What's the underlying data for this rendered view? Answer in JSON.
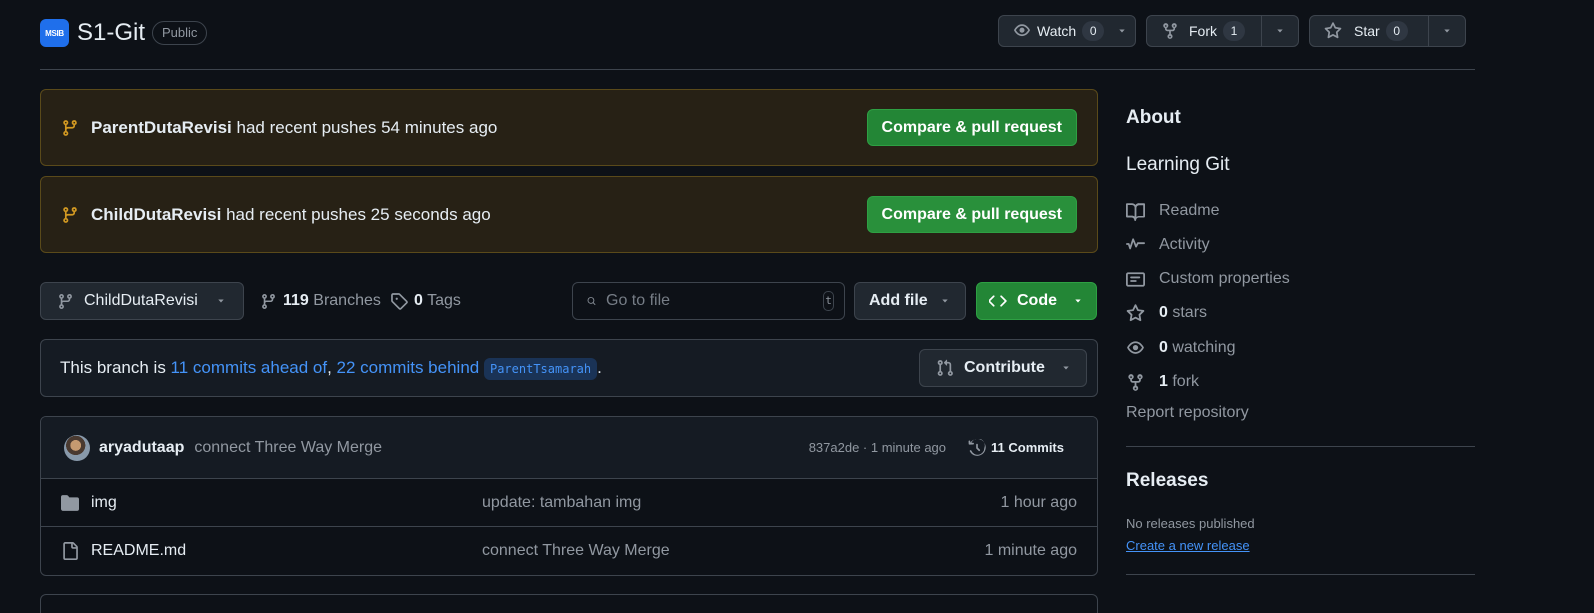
{
  "header": {
    "logo_text": "MSIB",
    "repo_name": "S1-Git",
    "visibility": "Public",
    "watch": {
      "label": "Watch",
      "count": "0"
    },
    "fork": {
      "label": "Fork",
      "count": "1"
    },
    "star": {
      "label": "Star",
      "count": "0"
    }
  },
  "banners": [
    {
      "branch": "ParentDutaRevisi",
      "text": " had recent pushes 54 minutes ago",
      "button": "Compare & pull request"
    },
    {
      "branch": "ChildDutaRevisi",
      "text": " had recent pushes 25 seconds ago",
      "button": "Compare & pull request"
    }
  ],
  "toolbar": {
    "current_branch": "ChildDutaRevisi",
    "branches_count": "119",
    "branches_label": "Branches",
    "tags_count": "0",
    "tags_label": "Tags",
    "search_placeholder": "Go to file",
    "search_kbd": "t",
    "add_file_label": "Add file",
    "code_label": "Code"
  },
  "branch_info": {
    "prefix": "This branch is ",
    "ahead": "11 commits ahead of",
    "sep": ", ",
    "behind": "22 commits behind",
    "space": " ",
    "base_branch": "ParentTsamarah",
    "suffix": ".",
    "contribute_label": "Contribute"
  },
  "latest_commit": {
    "author": "aryadutaap",
    "message": "connect Three Way Merge",
    "hash_time": "837a2de · 1 minute ago",
    "commits_label": "11 Commits"
  },
  "files": [
    {
      "name": "img",
      "type": "folder",
      "message": "update: tambahan img",
      "age": "1 hour ago"
    },
    {
      "name": "README.md",
      "type": "file",
      "message": "connect Three Way Merge",
      "age": "1 minute ago"
    }
  ],
  "sidebar": {
    "about_title": "About",
    "description": "Learning Git",
    "items": [
      {
        "icon": "book-icon",
        "count": "",
        "label": "Readme"
      },
      {
        "icon": "pulse-icon",
        "count": "",
        "label": "Activity"
      },
      {
        "icon": "note-icon",
        "count": "",
        "label": "Custom properties"
      },
      {
        "icon": "star-icon",
        "count": "0",
        "label": " stars"
      },
      {
        "icon": "eye-icon",
        "count": "0",
        "label": " watching"
      },
      {
        "icon": "fork-icon",
        "count": "1",
        "label": " fork"
      }
    ],
    "report_label": "Report repository",
    "releases_title": "Releases",
    "no_releases": "No releases published",
    "create_release": "Create a new release"
  },
  "colors": {
    "background": "#0d1117",
    "accent_green": "#238636",
    "link_blue": "#4493f8",
    "banner_bg": "#272115"
  }
}
